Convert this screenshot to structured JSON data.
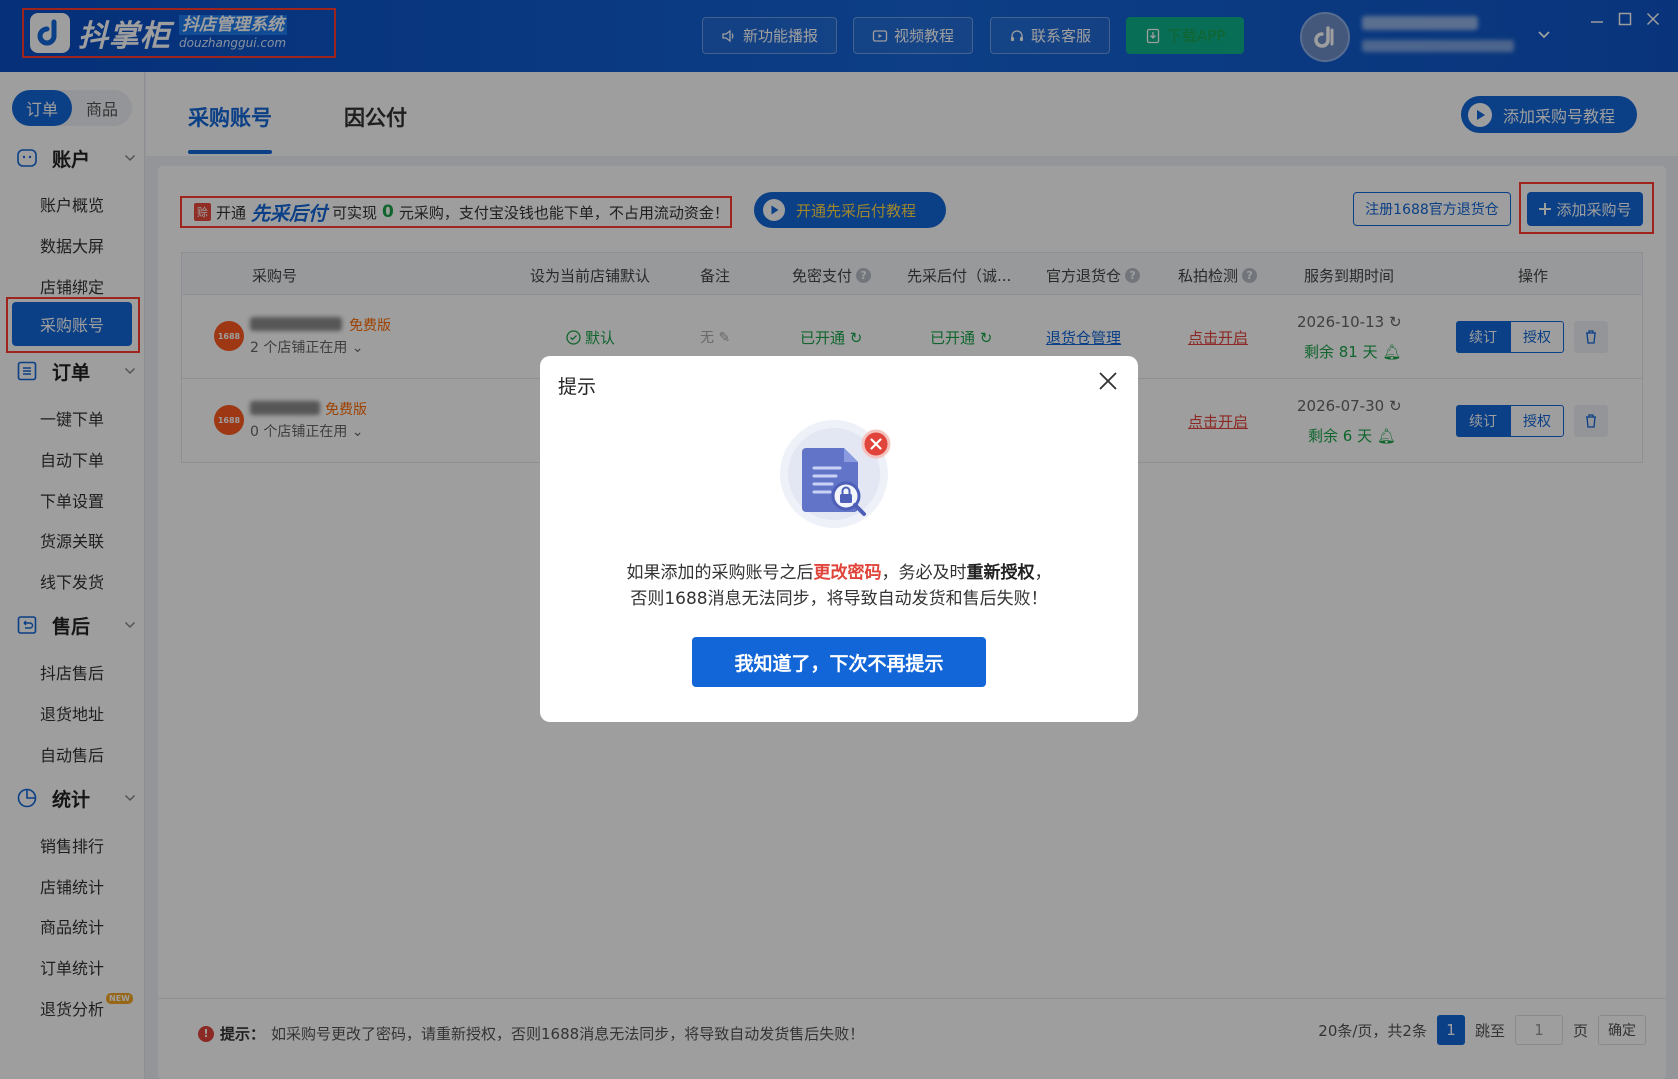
{
  "header": {
    "brand": "抖掌柜",
    "subtitle": "抖店管理系统",
    "domain": "douzhanggui.com",
    "buttons": [
      {
        "label": "新功能播报",
        "icon": "speaker-icon"
      },
      {
        "label": "视频教程",
        "icon": "video-icon"
      },
      {
        "label": "联系客服",
        "icon": "headset-icon"
      },
      {
        "label": "下载APP",
        "icon": "download-icon"
      }
    ]
  },
  "sidebar": {
    "segments": [
      "订单",
      "商品"
    ],
    "sections": [
      {
        "label": "账户",
        "items": [
          "账户概览",
          "数据大屏",
          "店铺绑定",
          "采购账号"
        ]
      },
      {
        "label": "订单",
        "items": [
          "一键下单",
          "自动下单",
          "下单设置",
          "货源关联",
          "线下发货"
        ]
      },
      {
        "label": "售后",
        "items": [
          "抖店售后",
          "退货地址",
          "自动售后"
        ]
      },
      {
        "label": "统计",
        "items": [
          "销售排行",
          "店铺统计",
          "商品统计",
          "订单统计",
          "退货分析"
        ]
      }
    ],
    "active_item": "采购账号",
    "new_badge": "NEW"
  },
  "tabs": [
    "采购账号",
    "因公付"
  ],
  "tutorial_button": "添加采购号教程",
  "notice": {
    "tag": "赊",
    "part1": "开通",
    "emphasis": "先采后付",
    "part2": "可实现",
    "zero": "0",
    "part3": "元采购，支付宝没钱也能下单，不占用流动资金！"
  },
  "open_tutorial_button": "开通先采后付教程",
  "register_button": "注册1688官方退货仓",
  "add_button": "添加采购号",
  "table": {
    "headers": [
      "采购号",
      "设为当前店铺默认",
      "备注",
      "免密支付",
      "先采后付（诚...",
      "官方退货仓",
      "私拍检测",
      "服务到期时间",
      "操作"
    ],
    "rows": [
      {
        "logo": "1688",
        "plan": "免费版",
        "shops": "2 个店铺正在用",
        "default": "默认",
        "note": "无",
        "nopwd": "已开通",
        "bnpl": "已开通",
        "warehouse": "退货仓管理",
        "private": "点击开启",
        "expire": "2026-10-13",
        "remain": "剩余 81 天",
        "renew": "续订",
        "auth": "授权"
      },
      {
        "logo": "1688",
        "plan": "免费版",
        "shops": "0 个店铺正在用",
        "private": "点击开启",
        "expire": "2026-07-30",
        "remain": "剩余 6 天",
        "renew": "续订",
        "auth": "授权"
      }
    ]
  },
  "footer": {
    "tip_label": "提示：",
    "tip_text": "如采购号更改了密码，请重新授权，否则1688消息无法同步，将导致自动发货售后失败！",
    "page_info": "20条/页，共2条",
    "current_page": "1",
    "jump_label": "跳至",
    "jump_value": "1",
    "page_unit": "页",
    "confirm": "确定"
  },
  "modal": {
    "title": "提示",
    "line1_a": "如果添加的采购账号之后",
    "line1_red": "更改密码",
    "line1_b": "，务必及时",
    "line1_bold": "重新授权",
    "line1_c": "，",
    "line2": "否则1688消息无法同步，将导致自动发货和售后失败！",
    "button": "我知道了，下次不再提示"
  },
  "colors": {
    "primary": "#1266d8",
    "danger": "#e0443a",
    "success": "#1aa34a",
    "highlight_frame": "#ff3b30"
  }
}
